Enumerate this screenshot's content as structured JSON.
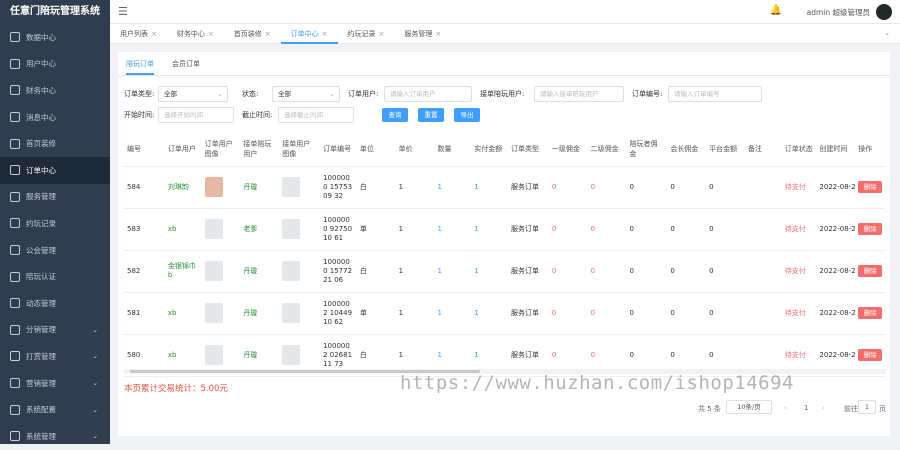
{
  "sidebar": {
    "brand": "任意门陪玩管理系统",
    "items": [
      {
        "label": "数据中心",
        "expand": false
      },
      {
        "label": "用户中心",
        "expand": false
      },
      {
        "label": "财务中心",
        "expand": false
      },
      {
        "label": "消息中心",
        "expand": false
      },
      {
        "label": "首页装修",
        "expand": false
      },
      {
        "label": "订单中心",
        "expand": false,
        "active": true
      },
      {
        "label": "服务管理",
        "expand": false
      },
      {
        "label": "约玩记录",
        "expand": false
      },
      {
        "label": "公会管理",
        "expand": false
      },
      {
        "label": "陪玩认证",
        "expand": false
      },
      {
        "label": "动态管理",
        "expand": false
      },
      {
        "label": "分销管理",
        "expand": true
      },
      {
        "label": "打赏管理",
        "expand": true
      },
      {
        "label": "营销管理",
        "expand": true
      },
      {
        "label": "系统配置",
        "expand": true
      },
      {
        "label": "系统管理",
        "expand": true
      }
    ]
  },
  "topbar": {
    "user": "admin 超级管理员"
  },
  "tabs": [
    "用户列表",
    "财务中心",
    "首页装修",
    "订单中心",
    "约玩记录",
    "服务管理"
  ],
  "subtabs": [
    "陪玩订单",
    "会员订单"
  ],
  "filters": {
    "order_type_label": "订单类型:",
    "order_type_value": "全部",
    "status_label": "状态:",
    "status_value": "全部",
    "order_user_label": "订单用户:",
    "order_user_ph": "请输入订单用户",
    "taker_label": "接单陪玩用户:",
    "taker_ph": "请输入接单陪玩用户",
    "order_no_label": "订单编号:",
    "order_no_ph": "请输入订单编号",
    "start_label": "开始时间:",
    "start_ph": "选择开始时间",
    "end_label": "截止时间:",
    "end_ph": "选择截止时间",
    "btn_search": "查询",
    "btn_reset": "重置",
    "btn_export": "导出"
  },
  "columns": [
    "编号",
    "订单用户",
    "订单用户图像",
    "接单陪玩用户",
    "接单用户图像",
    "订单编号",
    "单位",
    "单价",
    "数量",
    "实付金额",
    "订单类型",
    "一级佣金",
    "二级佣金",
    "陪玩者佣金",
    "会长佣金",
    "平台金额",
    "备注",
    "订单状态",
    "创建时间",
    "操作"
  ],
  "rows": [
    {
      "id": "584",
      "user": "刘琳韵",
      "user_color": "green",
      "img_photo": true,
      "taker": "丹璇",
      "order_no": "1000000 1575309 32",
      "unit": "白",
      "price": "1",
      "qty": "1",
      "paid": "1",
      "type": "服务订单",
      "c1": "0",
      "c2": "0",
      "c3": "0",
      "c4": "0",
      "c5": "0",
      "note": "",
      "status": "待支付",
      "time": "2022-08-2",
      "op": "删除"
    },
    {
      "id": "583",
      "user": "xb",
      "user_color": "green",
      "img_photo": false,
      "taker": "老爹",
      "order_no": "1000000 9275010 61",
      "unit": "单",
      "price": "1",
      "qty": "1",
      "paid": "1",
      "type": "服务订单",
      "c1": "0",
      "c2": "0",
      "c3": "0",
      "c4": "0",
      "c5": "0",
      "note": "",
      "status": "待支付",
      "time": "2022-08-2",
      "op": "删除"
    },
    {
      "id": "582",
      "user": "金银锦巾 b",
      "user_color": "green",
      "img_photo": false,
      "taker": "丹璇",
      "order_no": "1000000 1577221 06",
      "unit": "白",
      "price": "1",
      "qty": "1",
      "paid": "1",
      "type": "服务订单",
      "c1": "0",
      "c2": "0",
      "c3": "0",
      "c4": "0",
      "c5": "0",
      "note": "",
      "status": "待支付",
      "time": "2022-08-2",
      "op": "删除"
    },
    {
      "id": "581",
      "user": "xb",
      "user_color": "green",
      "img_photo": false,
      "taker": "丹璇",
      "order_no": "1000002 1044910 62",
      "unit": "单",
      "price": "1",
      "qty": "1",
      "paid": "1",
      "type": "服务订单",
      "c1": "0",
      "c2": "0",
      "c3": "0",
      "c4": "0",
      "c5": "0",
      "note": "",
      "status": "待支付",
      "time": "2022-08-2",
      "op": "删除"
    },
    {
      "id": "580",
      "user": "xb",
      "user_color": "green",
      "img_photo": false,
      "taker": "丹璇",
      "order_no": "1000002 0268111 73",
      "unit": "白",
      "price": "1",
      "qty": "1",
      "paid": "1",
      "type": "服务订单",
      "c1": "0",
      "c2": "0",
      "c3": "0",
      "c4": "0",
      "c5": "0",
      "note": "",
      "status": "待支付",
      "time": "2022-08-2",
      "op": "删除"
    }
  ],
  "stats": "本页累计交易统计：5.00元",
  "pagination": {
    "total": "共 5 条",
    "page_size": "10条/页",
    "current": "1",
    "goto_label": "前往",
    "goto_value": "1",
    "page_unit": "页"
  },
  "watermark": "https://www.huzhan.com/ishop14694"
}
